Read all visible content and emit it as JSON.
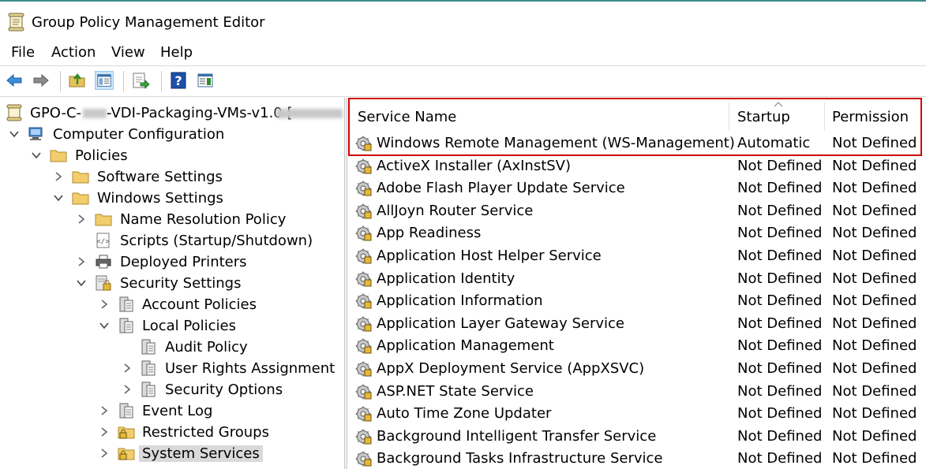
{
  "window": {
    "title": "Group Policy Management Editor"
  },
  "menu": [
    "File",
    "Action",
    "View",
    "Help"
  ],
  "toolbar": {
    "icons": [
      "back-arrow-icon",
      "forward-arrow-icon",
      "up-folder-icon",
      "show-hide-tree-icon",
      "export-list-icon",
      "help-icon",
      "show-action-pane-icon"
    ]
  },
  "tree": {
    "items": [
      {
        "label": "GPO-C-",
        "suffix": "-VDI-Packaging-VMs-v1.0 [",
        "icon": "gpo-scroll-icon"
      },
      {
        "label": "Computer Configuration",
        "icon": "computer-icon"
      },
      {
        "label": "Policies",
        "icon": "folder-icon"
      },
      {
        "label": "Software Settings",
        "icon": "folder-icon"
      },
      {
        "label": "Windows Settings",
        "icon": "folder-icon"
      },
      {
        "label": "Name Resolution Policy",
        "icon": "folder-icon"
      },
      {
        "label": "Scripts (Startup/Shutdown)",
        "icon": "scripts-icon"
      },
      {
        "label": "Deployed Printers",
        "icon": "printer-icon"
      },
      {
        "label": "Security Settings",
        "icon": "security-settings-icon"
      },
      {
        "label": "Account Policies",
        "icon": "policy-book-icon"
      },
      {
        "label": "Local Policies",
        "icon": "policy-book-icon"
      },
      {
        "label": "Audit Policy",
        "icon": "policy-book-icon"
      },
      {
        "label": "User Rights Assignment",
        "icon": "policy-book-icon"
      },
      {
        "label": "Security Options",
        "icon": "policy-book-icon"
      },
      {
        "label": "Event Log",
        "icon": "policy-book-icon"
      },
      {
        "label": "Restricted Groups",
        "icon": "locked-folder-icon"
      },
      {
        "label": "System Services",
        "icon": "locked-folder-icon"
      }
    ]
  },
  "list": {
    "columns": [
      "Service Name",
      "Startup",
      "Permission"
    ],
    "rows": [
      {
        "name": "Windows Remote Management (WS-Management)",
        "startup": "Automatic",
        "permission": "Not Defined"
      },
      {
        "name": "ActiveX Installer (AxInstSV)",
        "startup": "Not Defined",
        "permission": "Not Defined"
      },
      {
        "name": "Adobe Flash Player Update Service",
        "startup": "Not Defined",
        "permission": "Not Defined"
      },
      {
        "name": "AllJoyn Router Service",
        "startup": "Not Defined",
        "permission": "Not Defined"
      },
      {
        "name": "App Readiness",
        "startup": "Not Defined",
        "permission": "Not Defined"
      },
      {
        "name": "Application Host Helper Service",
        "startup": "Not Defined",
        "permission": "Not Defined"
      },
      {
        "name": "Application Identity",
        "startup": "Not Defined",
        "permission": "Not Defined"
      },
      {
        "name": "Application Information",
        "startup": "Not Defined",
        "permission": "Not Defined"
      },
      {
        "name": "Application Layer Gateway Service",
        "startup": "Not Defined",
        "permission": "Not Defined"
      },
      {
        "name": "Application Management",
        "startup": "Not Defined",
        "permission": "Not Defined"
      },
      {
        "name": "AppX Deployment Service (AppXSVC)",
        "startup": "Not Defined",
        "permission": "Not Defined"
      },
      {
        "name": "ASP.NET State Service",
        "startup": "Not Defined",
        "permission": "Not Defined"
      },
      {
        "name": "Auto Time Zone Updater",
        "startup": "Not Defined",
        "permission": "Not Defined"
      },
      {
        "name": "Background Intelligent Transfer Service",
        "startup": "Not Defined",
        "permission": "Not Defined"
      },
      {
        "name": "Background Tasks Infrastructure Service",
        "startup": "Not Defined",
        "permission": "Not Defined"
      }
    ]
  },
  "colors": {
    "highlight_border": "#d00000",
    "selection": "#d9d9d9"
  }
}
